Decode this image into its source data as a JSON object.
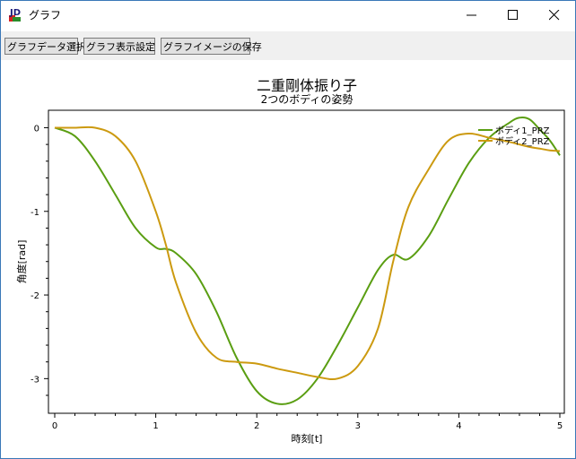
{
  "window": {
    "title": "グラフ"
  },
  "toolbar": {
    "select_data_label": "グラフデータ選択",
    "display_settings_label": "グラフ表示設定",
    "save_image_label": "グラフイメージの保存"
  },
  "colors": {
    "series1": "#5a9e12",
    "series2": "#cc9a10",
    "titlebar_border": "#3a78b8"
  },
  "chart_data": {
    "type": "line",
    "title": "二重剛体振り子",
    "subtitle": "2つのボディの姿勢",
    "xlabel": "時刻[t]",
    "ylabel": "角度[rad]",
    "xlim": [
      0,
      5
    ],
    "ylim": [
      -3.35,
      0.08
    ],
    "xticks": [
      "0",
      "1",
      "2",
      "3",
      "4",
      "5"
    ],
    "yticks": [
      "0",
      "-1",
      "-2",
      "-3"
    ],
    "legend_position": "top-right",
    "grid": false,
    "x": [
      0,
      0.2,
      0.4,
      0.6,
      0.8,
      1.0,
      1.1,
      1.2,
      1.4,
      1.6,
      1.8,
      2.0,
      2.2,
      2.4,
      2.6,
      2.8,
      3.0,
      3.2,
      3.35,
      3.5,
      3.7,
      3.9,
      4.1,
      4.3,
      4.5,
      4.6,
      4.7,
      4.8,
      4.9,
      5.0
    ],
    "series": [
      {
        "name": "ボディ1_PRZ",
        "color": "#5a9e12",
        "values": [
          0,
          -0.1,
          -0.4,
          -0.8,
          -1.2,
          -1.43,
          -1.45,
          -1.5,
          -1.75,
          -2.2,
          -2.75,
          -3.15,
          -3.3,
          -3.25,
          -3.0,
          -2.6,
          -2.15,
          -1.7,
          -1.52,
          -1.57,
          -1.3,
          -0.85,
          -0.42,
          -0.12,
          0.06,
          0.12,
          0.1,
          -0.02,
          -0.15,
          -0.33
        ]
      },
      {
        "name": "ボディ2_PRZ",
        "color": "#cc9a10",
        "values": [
          0,
          0,
          0,
          -0.1,
          -0.4,
          -1.0,
          -1.4,
          -1.85,
          -2.45,
          -2.75,
          -2.8,
          -2.82,
          -2.88,
          -2.93,
          -2.98,
          -3.0,
          -2.85,
          -2.4,
          -1.6,
          -0.95,
          -0.5,
          -0.15,
          -0.07,
          -0.12,
          -0.17,
          -0.2,
          -0.23,
          -0.25,
          -0.27,
          -0.28
        ]
      }
    ]
  }
}
